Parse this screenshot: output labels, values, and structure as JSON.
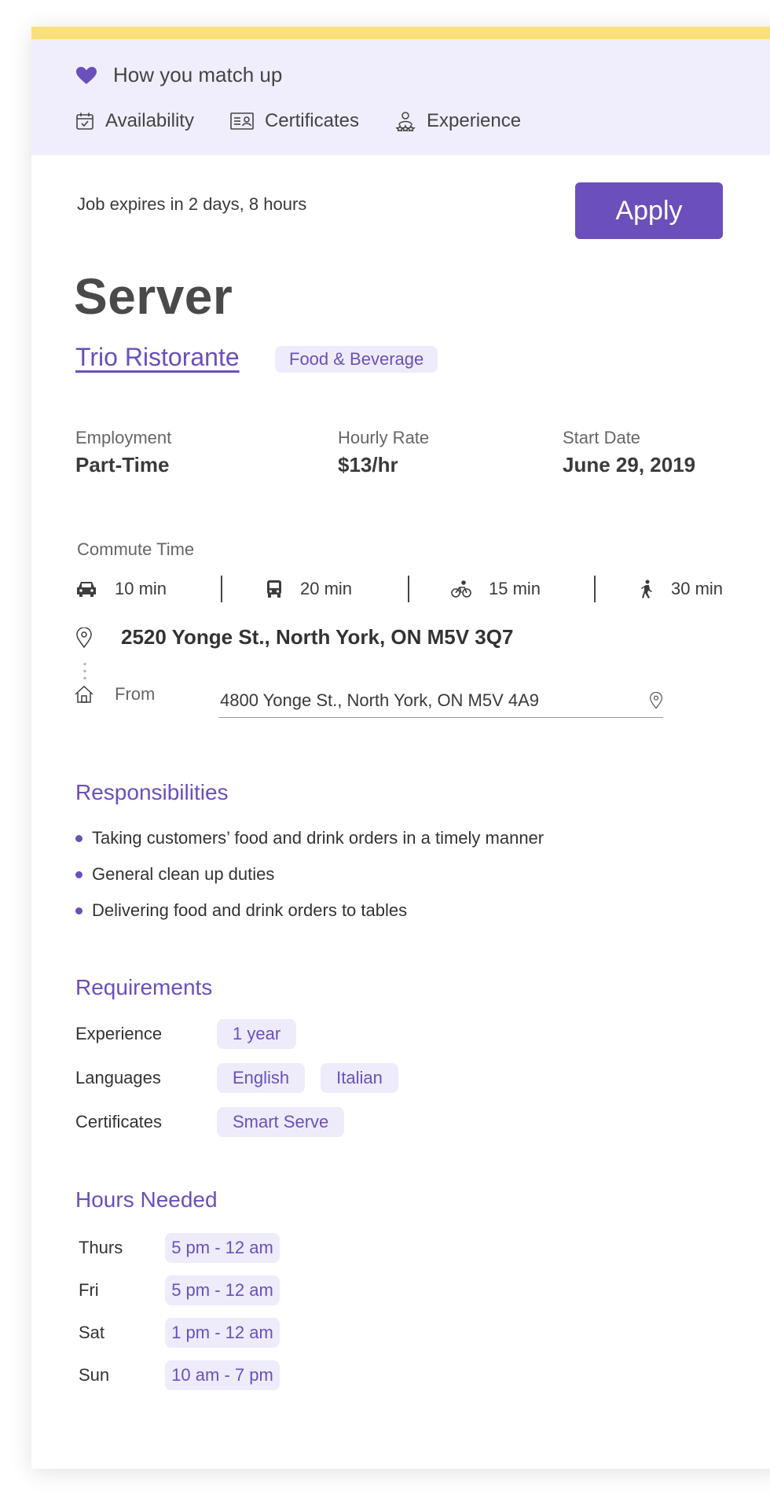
{
  "match": {
    "title": "How you match up",
    "tabs": [
      {
        "label": "Availability",
        "icon": "calendar-check-icon"
      },
      {
        "label": "Certificates",
        "icon": "id-card-icon"
      },
      {
        "label": "Experience",
        "icon": "person-stars-icon"
      }
    ]
  },
  "job": {
    "expires": "Job expires in 2 days, 8 hours",
    "apply_label": "Apply",
    "title": "Server",
    "employer": "Trio Ristorante",
    "category": "Food & Beverage"
  },
  "stats": [
    {
      "label": "Employment",
      "value": "Part-Time"
    },
    {
      "label": "Hourly Rate",
      "value": "$13/hr"
    },
    {
      "label": "Start Date",
      "value": "June 29, 2019"
    }
  ],
  "commute": {
    "label": "Commute Time",
    "modes": [
      {
        "icon": "car-icon",
        "time": "10 min"
      },
      {
        "icon": "bus-icon",
        "time": "20 min"
      },
      {
        "icon": "bicycle-icon",
        "time": "15 min"
      },
      {
        "icon": "walking-icon",
        "time": "30 min"
      }
    ],
    "destination": "2520 Yonge St., North York, ON M5V 3Q7",
    "from_label": "From",
    "from_value": "4800 Yonge St., North York, ON M5V 4A9"
  },
  "responsibilities": {
    "heading": "Responsibilities",
    "items": [
      "Taking customers’ food and drink orders in a timely manner",
      "General clean up duties",
      "Delivering food and drink orders to tables"
    ]
  },
  "requirements": {
    "heading": "Requirements",
    "experience_label": "Experience",
    "experience": "1 year",
    "languages_label": "Languages",
    "languages": [
      "English",
      "Italian"
    ],
    "certificates_label": "Certificates",
    "certificates": "Smart Serve"
  },
  "hours": {
    "heading": "Hours Needed",
    "rows": [
      {
        "day": "Thurs",
        "time": "5 pm - 12 am"
      },
      {
        "day": "Fri",
        "time": "5 pm - 12 am"
      },
      {
        "day": "Sat",
        "time": "1 pm - 12 am"
      },
      {
        "day": "Sun",
        "time": "10 am - 7 pm"
      }
    ]
  },
  "colors": {
    "accent": "#6b4fbb",
    "chip_bg": "#eeecfb",
    "header_bg": "#f0eefc",
    "top_bar": "#fce07a"
  }
}
